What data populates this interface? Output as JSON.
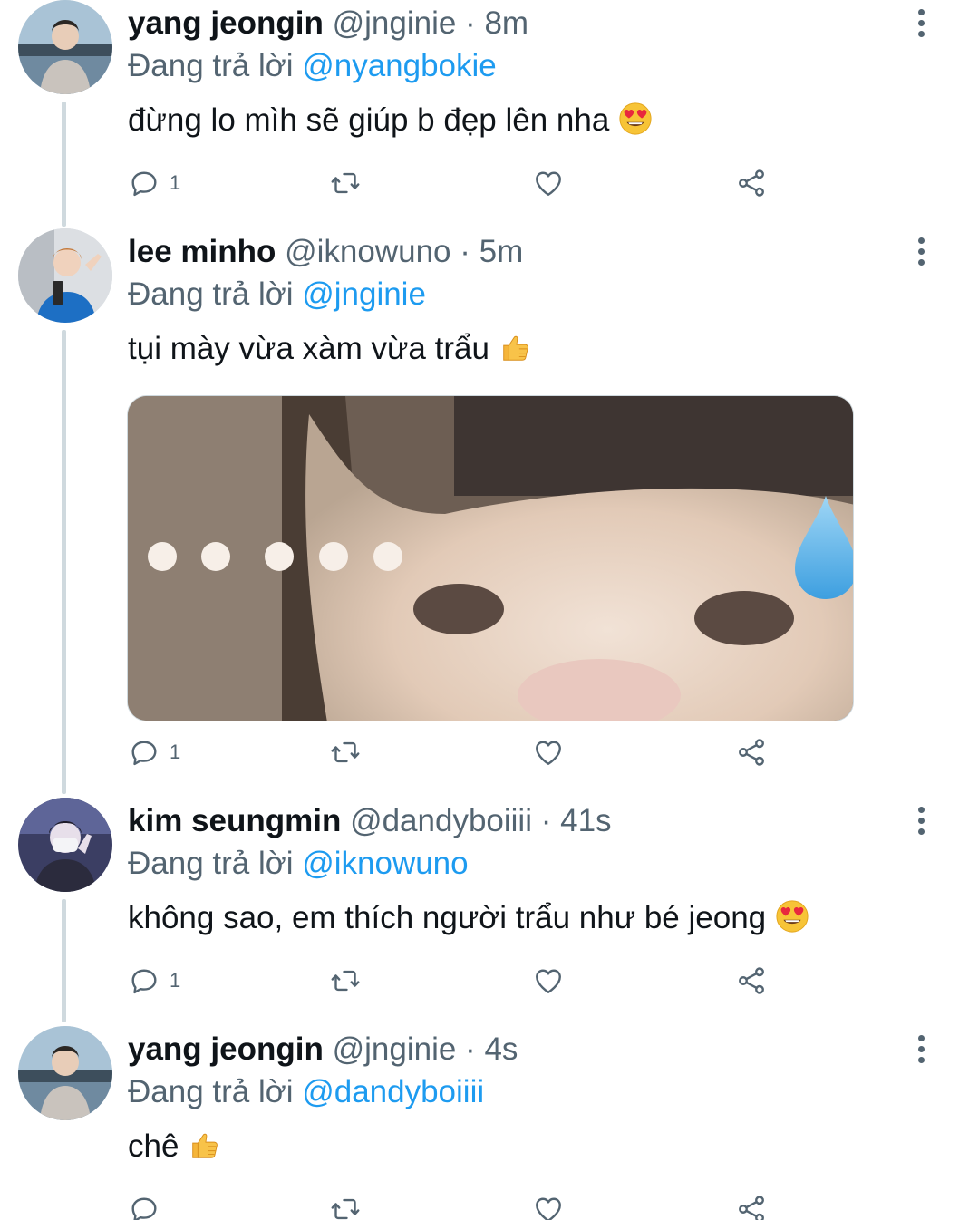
{
  "tweets": [
    {
      "name": "yang jeongin",
      "handle": "@jnginie",
      "dot": "·",
      "time": "8m",
      "reply_prefix": "Đang trả lời",
      "reply_to": "@nyangbokie",
      "text": "đừng lo mìh sẽ giúp b đẹp lên nha",
      "emoji": "heart-eyes-emoji",
      "reply_count": "1"
    },
    {
      "name": "lee minho",
      "handle": "@iknowuno",
      "dot": "·",
      "time": "5m",
      "reply_prefix": "Đang trả lời",
      "reply_to": "@jnginie",
      "text": "tụi mày vừa xàm vừa trẩu",
      "emoji": "thumbs-up-emoji",
      "reply_count": "1"
    },
    {
      "name": "kim seungmin",
      "handle": "@dandyboiiii",
      "dot": "·",
      "time": "41s",
      "reply_prefix": "Đang trả lời",
      "reply_to": "@iknowuno",
      "text": "không sao, em thích người trẩu như bé jeong",
      "emoji": "heart-eyes-emoji",
      "reply_count": "1"
    },
    {
      "name": "yang jeongin",
      "handle": "@jnginie",
      "dot": "·",
      "time": "4s",
      "reply_prefix": "Đang trả lời",
      "reply_to": "@dandyboiiii",
      "text": "chê",
      "emoji": "thumbs-up-emoji",
      "reply_count": ""
    }
  ],
  "icons": {
    "reply": "reply-icon",
    "retweet": "retweet-icon",
    "like": "heart-icon",
    "share": "share-icon",
    "more": "more-icon"
  },
  "colors": {
    "link": "#1d9bf0",
    "secondary_text": "#536471",
    "primary_text": "#0f1419",
    "thread_line": "#cfd9de"
  }
}
